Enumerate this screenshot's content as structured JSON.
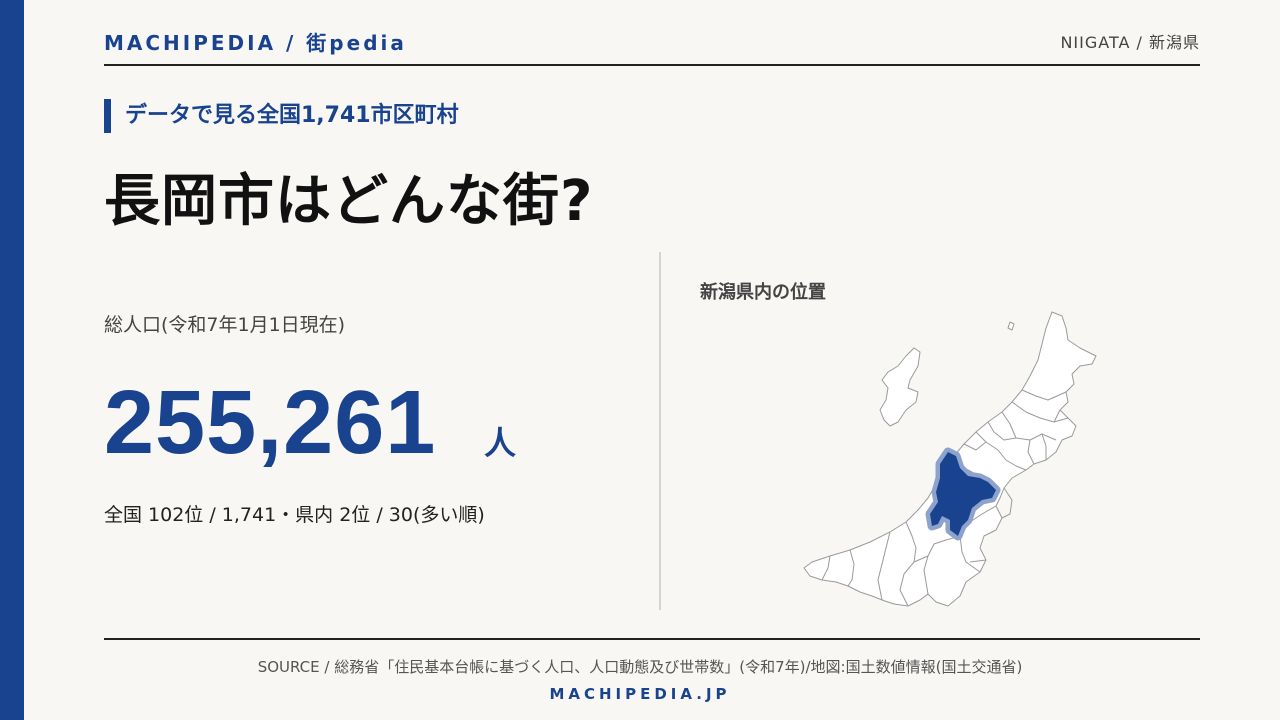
{
  "header": {
    "brand": "MACHIPEDIA / 街pedia",
    "region": "NIIGATA / 新潟県"
  },
  "kicker": "データで見る全国1,741市区町村",
  "title": "長岡市はどんな街?",
  "stat": {
    "label": "総人口(令和7年1月1日現在)",
    "value": "255,261",
    "unit": "人",
    "rank": "全国 102位 / 1,741・県内 2位 / 30(多い順)"
  },
  "map": {
    "title": "新潟県内の位置",
    "highlight_color": "#1a438f",
    "halo_color": "#8ea3cc",
    "base_color": "#ffffff",
    "border_color": "#9a9a9a"
  },
  "footer": {
    "source": "SOURCE / 総務省「住民基本台帳に基づく人口、人口動態及び世帯数」(令和7年)/地図:国土数値情報(国土交通省)",
    "site": "MACHIPEDIA.JP"
  },
  "colors": {
    "accent": "#1a438f",
    "background": "#f8f7f4",
    "text": "#222222"
  }
}
